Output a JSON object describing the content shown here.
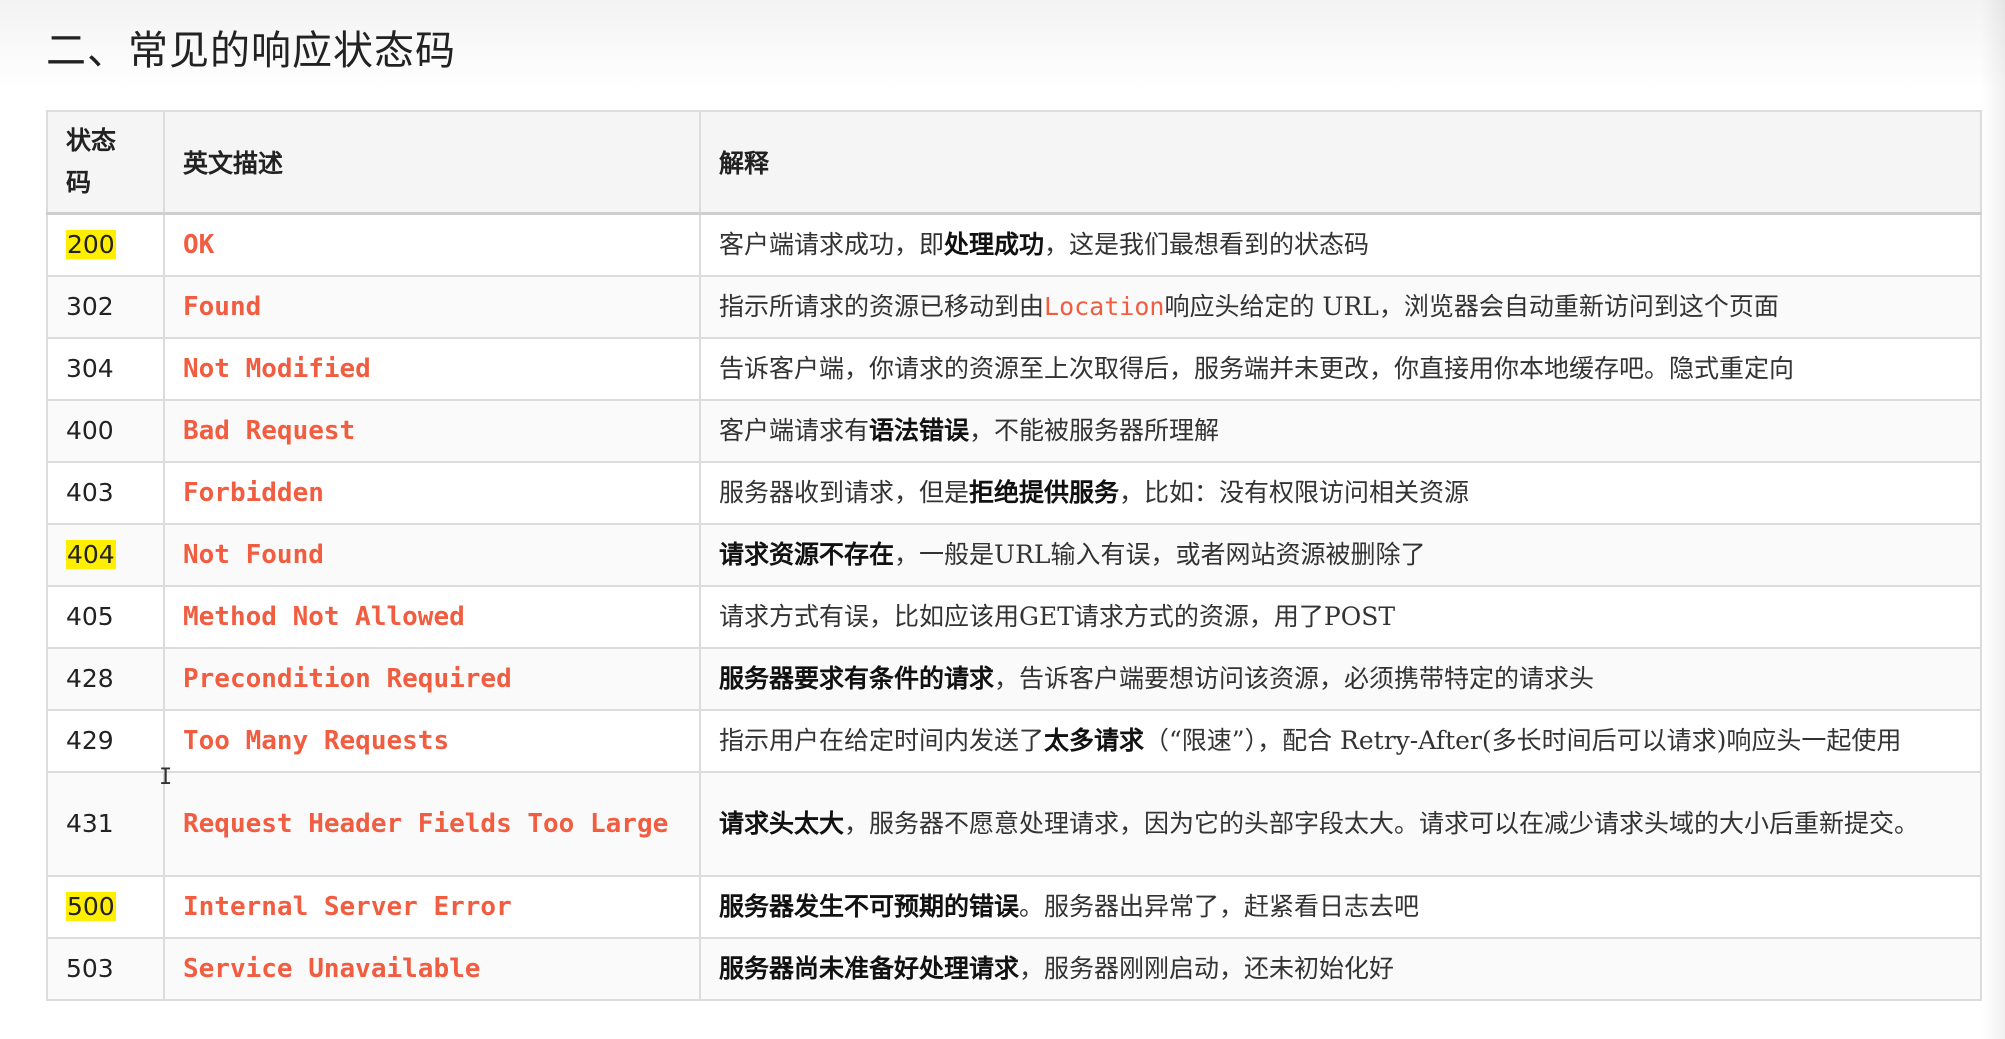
{
  "heading": "二、常见的响应状态码",
  "table": {
    "headers": {
      "code_line1": "状态",
      "code_line2": "码",
      "english": "英文描述",
      "explanation": "解释"
    },
    "rows": [
      {
        "code": "200",
        "highlight": true,
        "english": "OK",
        "desc": [
          {
            "t": "客户端请求成功，即"
          },
          {
            "t": "处理成功",
            "b": true
          },
          {
            "t": "，这是我们最想看到的状态码"
          }
        ]
      },
      {
        "code": "302",
        "highlight": false,
        "english": "Found",
        "desc": [
          {
            "t": "指示所请求的资源已移动到由"
          },
          {
            "t": "Location",
            "code": true
          },
          {
            "t": "响应头给定的 URL，浏览器会自动重新访问到这个页面"
          }
        ]
      },
      {
        "code": "304",
        "highlight": false,
        "english": "Not Modified",
        "desc": [
          {
            "t": "告诉客户端，你请求的资源至上次取得后，服务端并未更改，你直接用你本地缓存吧。隐式重定向"
          }
        ]
      },
      {
        "code": "400",
        "highlight": false,
        "english": "Bad Request",
        "desc": [
          {
            "t": "客户端请求有"
          },
          {
            "t": "语法错误",
            "b": true
          },
          {
            "t": "，不能被服务器所理解"
          }
        ]
      },
      {
        "code": "403",
        "highlight": false,
        "english": "Forbidden",
        "desc": [
          {
            "t": "服务器收到请求，但是"
          },
          {
            "t": "拒绝提供服务",
            "b": true
          },
          {
            "t": "，比如：没有权限访问相关资源"
          }
        ]
      },
      {
        "code": "404",
        "highlight": true,
        "english": "Not Found",
        "desc": [
          {
            "t": "请求资源不存在",
            "b": true
          },
          {
            "t": "，一般是URL输入有误，或者网站资源被删除了"
          }
        ]
      },
      {
        "code": "405",
        "highlight": false,
        "english": "Method Not Allowed",
        "desc": [
          {
            "t": "请求方式有误，比如应该用GET请求方式的资源，用了POST"
          }
        ]
      },
      {
        "code": "428",
        "highlight": false,
        "english": "Precondition Required",
        "desc": [
          {
            "t": "服务器要求有条件的请求",
            "b": true
          },
          {
            "t": "，告诉客户端要想访问该资源，必须携带特定的请求头"
          }
        ]
      },
      {
        "code": "429",
        "highlight": false,
        "english": "Too Many Requests",
        "desc": [
          {
            "t": "指示用户在给定时间内发送了"
          },
          {
            "t": "太多请求",
            "b": true
          },
          {
            "t": "（“限速”），配合 Retry-After(多长时间后可以请求)响应头一起使用"
          }
        ]
      },
      {
        "code": "431",
        "highlight": false,
        "tall": true,
        "english": "Request Header Fields Too Large",
        "desc": [
          {
            "t": "请求头太大",
            "b": true
          },
          {
            "t": "，服务器不愿意处理请求，因为它的头部字段太大。请求可以在减少请求头域的大小后重新提交。"
          }
        ]
      },
      {
        "code": "500",
        "highlight": true,
        "english": "Internal Server Error",
        "desc": [
          {
            "t": "服务器发生不可预期的错误",
            "b": true
          },
          {
            "t": "。服务器出异常了，赶紧看日志去吧"
          }
        ]
      },
      {
        "code": "503",
        "highlight": false,
        "english": "Service Unavailable",
        "desc": [
          {
            "t": "服务器尚未准备好处理请求",
            "b": true
          },
          {
            "t": "，服务器刚刚启动，还未初始化好"
          }
        ]
      }
    ]
  },
  "colors": {
    "english_text": "#f05d40",
    "highlight": "#ffee00",
    "border": "#dcdcdc"
  },
  "icons": {
    "cursor": "text-cursor-icon"
  }
}
